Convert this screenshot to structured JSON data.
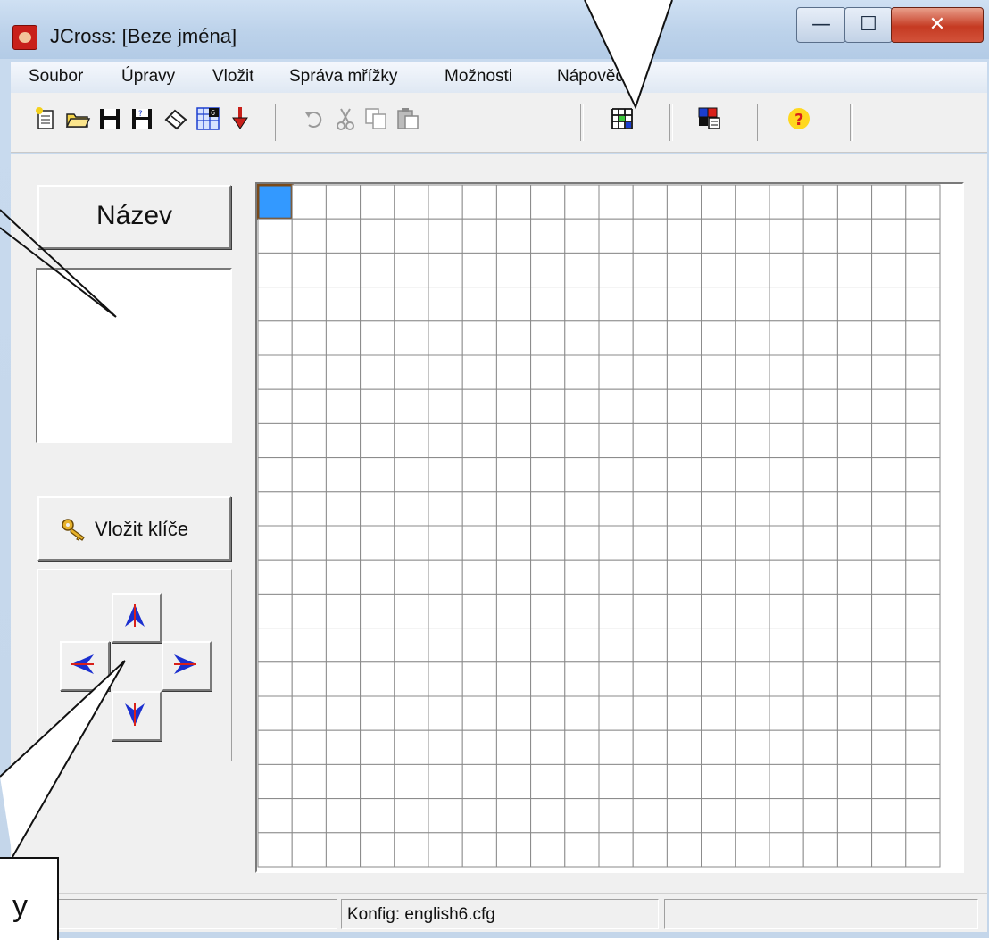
{
  "window": {
    "title": "JCross: [Beze jména]",
    "min_glyph": "—",
    "max_glyph": "☐",
    "close_glyph": "✕"
  },
  "menu": {
    "items": [
      "Soubor",
      "Úpravy",
      "Vložit",
      "Správa mřížky",
      "Možnosti",
      "Nápověda"
    ]
  },
  "toolbar": {
    "icons": [
      "new-file-icon",
      "open-folder-icon",
      "save-icon",
      "save-as-icon",
      "erase-icon",
      "web-icon",
      "export-icon",
      "undo-icon",
      "cut-icon",
      "copy-icon",
      "paste-icon",
      "grid-icon",
      "colors-icon",
      "help-icon"
    ]
  },
  "left_panel": {
    "title_button": "Název",
    "keys_button": "Vložit klíče"
  },
  "grid": {
    "columns": 20,
    "rows": 20,
    "selected_cell": [
      0,
      0
    ],
    "selected_color": "#3399ff"
  },
  "statusbar": {
    "config": "Konfig: english6.cfg"
  },
  "callout": {
    "text": "y"
  }
}
